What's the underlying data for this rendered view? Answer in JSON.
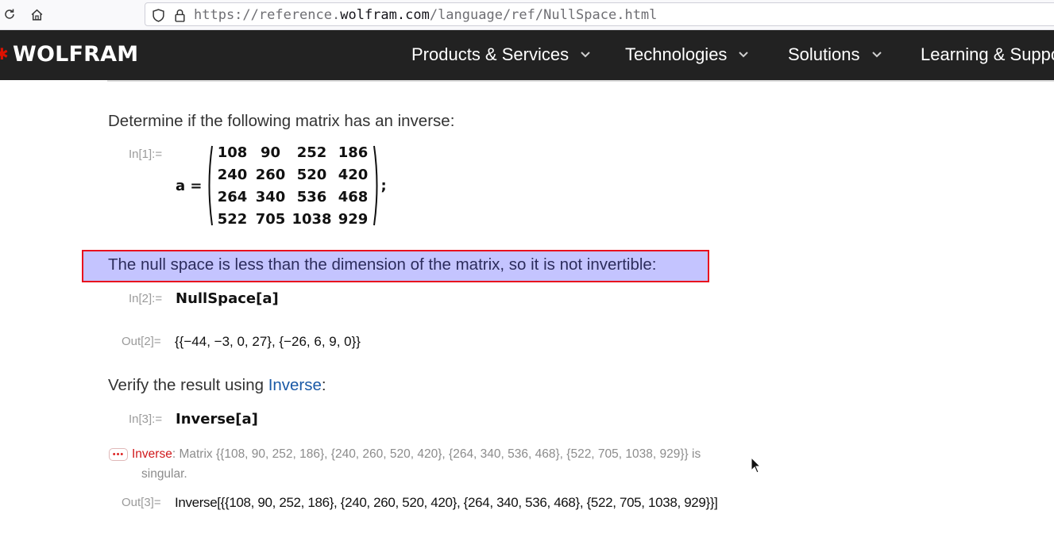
{
  "browser": {
    "reload_icon": "reload-icon",
    "home_icon": "home-icon",
    "shield_icon": "shield-icon",
    "lock_icon": "lock-icon",
    "url_prefix": "https://reference.",
    "url_host": "wolfram.com",
    "url_path": "/language/ref/NullSpace.html"
  },
  "navbar": {
    "logo": "WOLFRAM",
    "items": [
      {
        "label": "Products & Services"
      },
      {
        "label": "Technologies"
      },
      {
        "label": "Solutions"
      },
      {
        "label": "Learning & Suppo"
      }
    ]
  },
  "content": {
    "intro_text": "Determine if the following matrix has an inverse:",
    "in1_label": "In[1]:=",
    "matrix_lhs": "a =",
    "matrix_semicolon": ";",
    "matrix": [
      [
        "108",
        "90",
        "252",
        "186"
      ],
      [
        "240",
        "260",
        "520",
        "420"
      ],
      [
        "264",
        "340",
        "536",
        "468"
      ],
      [
        "522",
        "705",
        "1038",
        "929"
      ]
    ],
    "highlighted_text": "The null space is less than the dimension of the matrix, so it is not invertible:",
    "in2_label": "In[2]:=",
    "in2_code": "NullSpace[a]",
    "out2_label": "Out[2]=",
    "out2_value": "{{−44, −3, 0, 27}, {−26, 6, 9, 0}}",
    "verify_prefix": "Verify the result using ",
    "verify_link": "Inverse",
    "verify_suffix": ":",
    "in3_label": "In[3]:=",
    "in3_code": "Inverse[a]",
    "message": {
      "badge": "•••",
      "head": "Inverse",
      "colon": ": ",
      "line1": "Matrix {{108, 90, 252, 186}, {240, 260, 520, 420}, {264, 340, 536, 468}, {522, 705, 1038, 929}} is",
      "line2": "singular."
    },
    "out3_label": "Out[3]=",
    "out3_value": "Inverse[{{108, 90, 252, 186}, {240, 260, 520, 420}, {264, 340, 536, 468}, {522, 705, 1038, 929}}]"
  },
  "colors": {
    "nav_bg": "#222222",
    "brand_red": "#dd1100",
    "highlight_fill": "#c4c4ff",
    "highlight_border": "#e8101e",
    "link": "#1a59a6",
    "message_red": "#d0191c"
  }
}
